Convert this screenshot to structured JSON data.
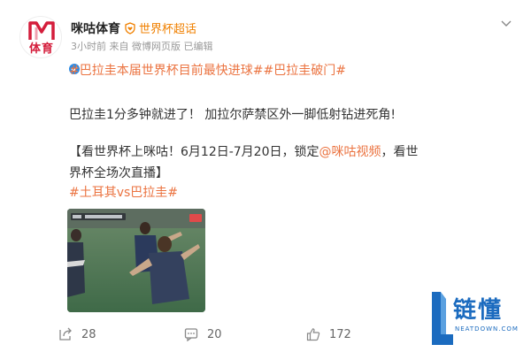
{
  "post": {
    "author": {
      "avatar_text": "体育",
      "name": "咪咕体育",
      "topic": "世界杯超话"
    },
    "meta": "3小时前  来自 微博网页版 已编辑",
    "hashtags": [
      "#巴拉圭本届世界杯目前最快进球#",
      "#巴拉圭破门#"
    ],
    "text_1": "巴拉圭1分多钟就进了！ 加拉尔萨禁区外一脚低射钻进死角!",
    "text_2_prefix": "【看世界杯上咪咕！6月12日-7月20日，锁定",
    "text_2_link": "@咪咕视频",
    "text_2_suffix": "，看世界杯全场次直播】",
    "hashtag_3": "#土耳其vs巴拉圭#"
  },
  "actions": {
    "share_count": "28",
    "comment_count": "20",
    "like_count": "172"
  },
  "watermark": {
    "text": "链懂",
    "sub": "NEATDOWN.COM"
  },
  "colors": {
    "brand_red": "#d41d3b",
    "hashtag": "#eb7340",
    "verified_blue": "#2b8ce6",
    "watermark_blue": "#1b6bbf"
  },
  "icons": [
    "shield-heart-icon",
    "chevron-down-icon",
    "share-icon",
    "comment-icon",
    "like-icon",
    "verified-icon"
  ]
}
